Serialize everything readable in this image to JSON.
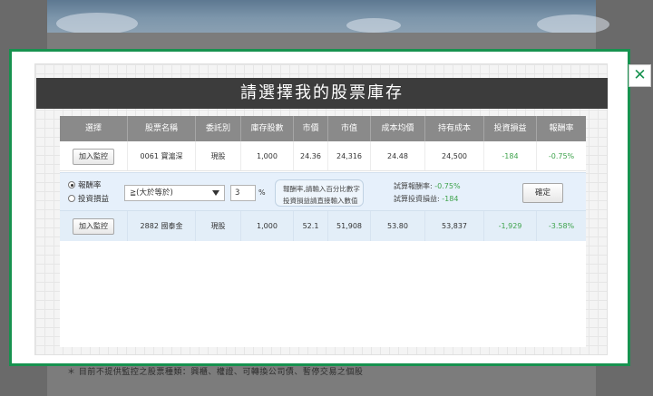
{
  "background": {
    "note": "＊ 目前不提供監控之股票種類：興櫃、權證、可轉換公司債、暫停交易之個股"
  },
  "modal": {
    "close_label": "✕",
    "title": "請選擇我的股票庫存",
    "columns": [
      "選擇",
      "股票名稱",
      "委託別",
      "庫存股數",
      "市價",
      "市值",
      "成本均價",
      "持有成本",
      "投資損益",
      "報酬率"
    ],
    "rows": [
      {
        "button": "加入監控",
        "name": "0061 寶滬深",
        "type": "現股",
        "shares": "1,000",
        "price": "24.36",
        "value": "24,316",
        "avg_cost": "24.48",
        "cost": "24,500",
        "pnl": "-184",
        "return": "-0.75%"
      },
      {
        "button": "加入監控",
        "name": "2882 國泰金",
        "type": "現股",
        "shares": "1,000",
        "price": "52.1",
        "value": "51,908",
        "avg_cost": "53.80",
        "cost": "53,837",
        "pnl": "-1,929",
        "return": "-3.58%"
      }
    ],
    "settings": {
      "radio_return": "報酬率",
      "radio_pnl": "投資損益",
      "selected": "return",
      "condition": "≧(大於等於)",
      "threshold": "3",
      "unit": "%",
      "hint_line1": "報酬率,請輸入百分比數字",
      "hint_line2": "投資損益請直接輸入數值",
      "calc_return_label": "試算報酬率:",
      "calc_return_value": "-0.75%",
      "calc_pnl_label": "試算投資損益:",
      "calc_pnl_value": "-184",
      "confirm": "確定"
    }
  },
  "colors": {
    "accent_green": "#17924f",
    "positive_text": "#3fa34d",
    "title_bar": "#3c3c3c",
    "header": "#8a8a8a"
  }
}
